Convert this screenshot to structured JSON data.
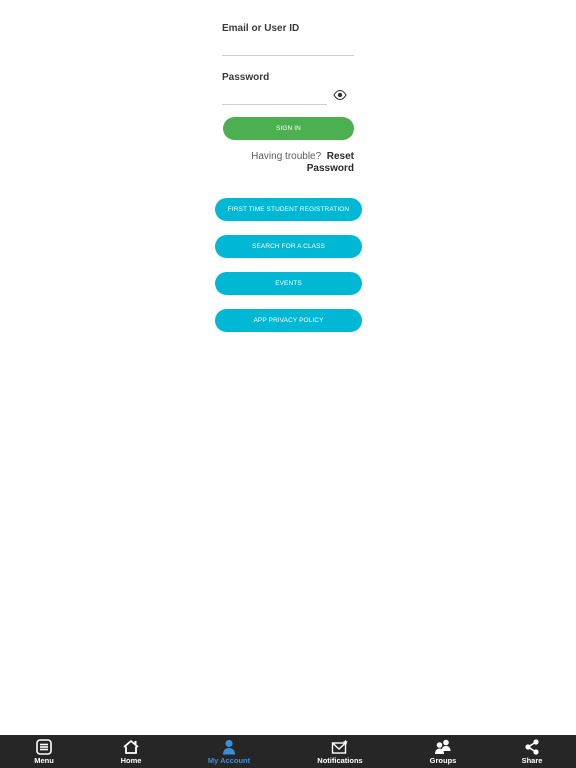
{
  "login": {
    "email_label": "Email or User ID",
    "email_value": "",
    "password_label": "Password",
    "password_value": "",
    "sign_in_label": "SIGN IN",
    "trouble_text": "Having trouble?",
    "reset_label": "Reset Password"
  },
  "actions": [
    {
      "label": "FIRST TIME STUDENT REGISTRATION"
    },
    {
      "label": "SEARCH FOR A CLASS"
    },
    {
      "label": "EVENTS"
    },
    {
      "label": "APP PRIVACY POLICY"
    }
  ],
  "tabbar": {
    "active": "My Account",
    "tabs": [
      {
        "label": "Menu",
        "icon": "menu-icon"
      },
      {
        "label": "Home",
        "icon": "home-icon"
      },
      {
        "label": "My Account",
        "icon": "account-icon"
      },
      {
        "label": "Notifications",
        "icon": "notifications-icon"
      },
      {
        "label": "Groups",
        "icon": "groups-icon"
      },
      {
        "label": "Share",
        "icon": "share-icon"
      }
    ]
  },
  "colors": {
    "sign_in": "#4caf50",
    "action_buttons": "#00b8d4",
    "tabbar_bg": "#262626",
    "tab_active": "#3a8fd6"
  }
}
